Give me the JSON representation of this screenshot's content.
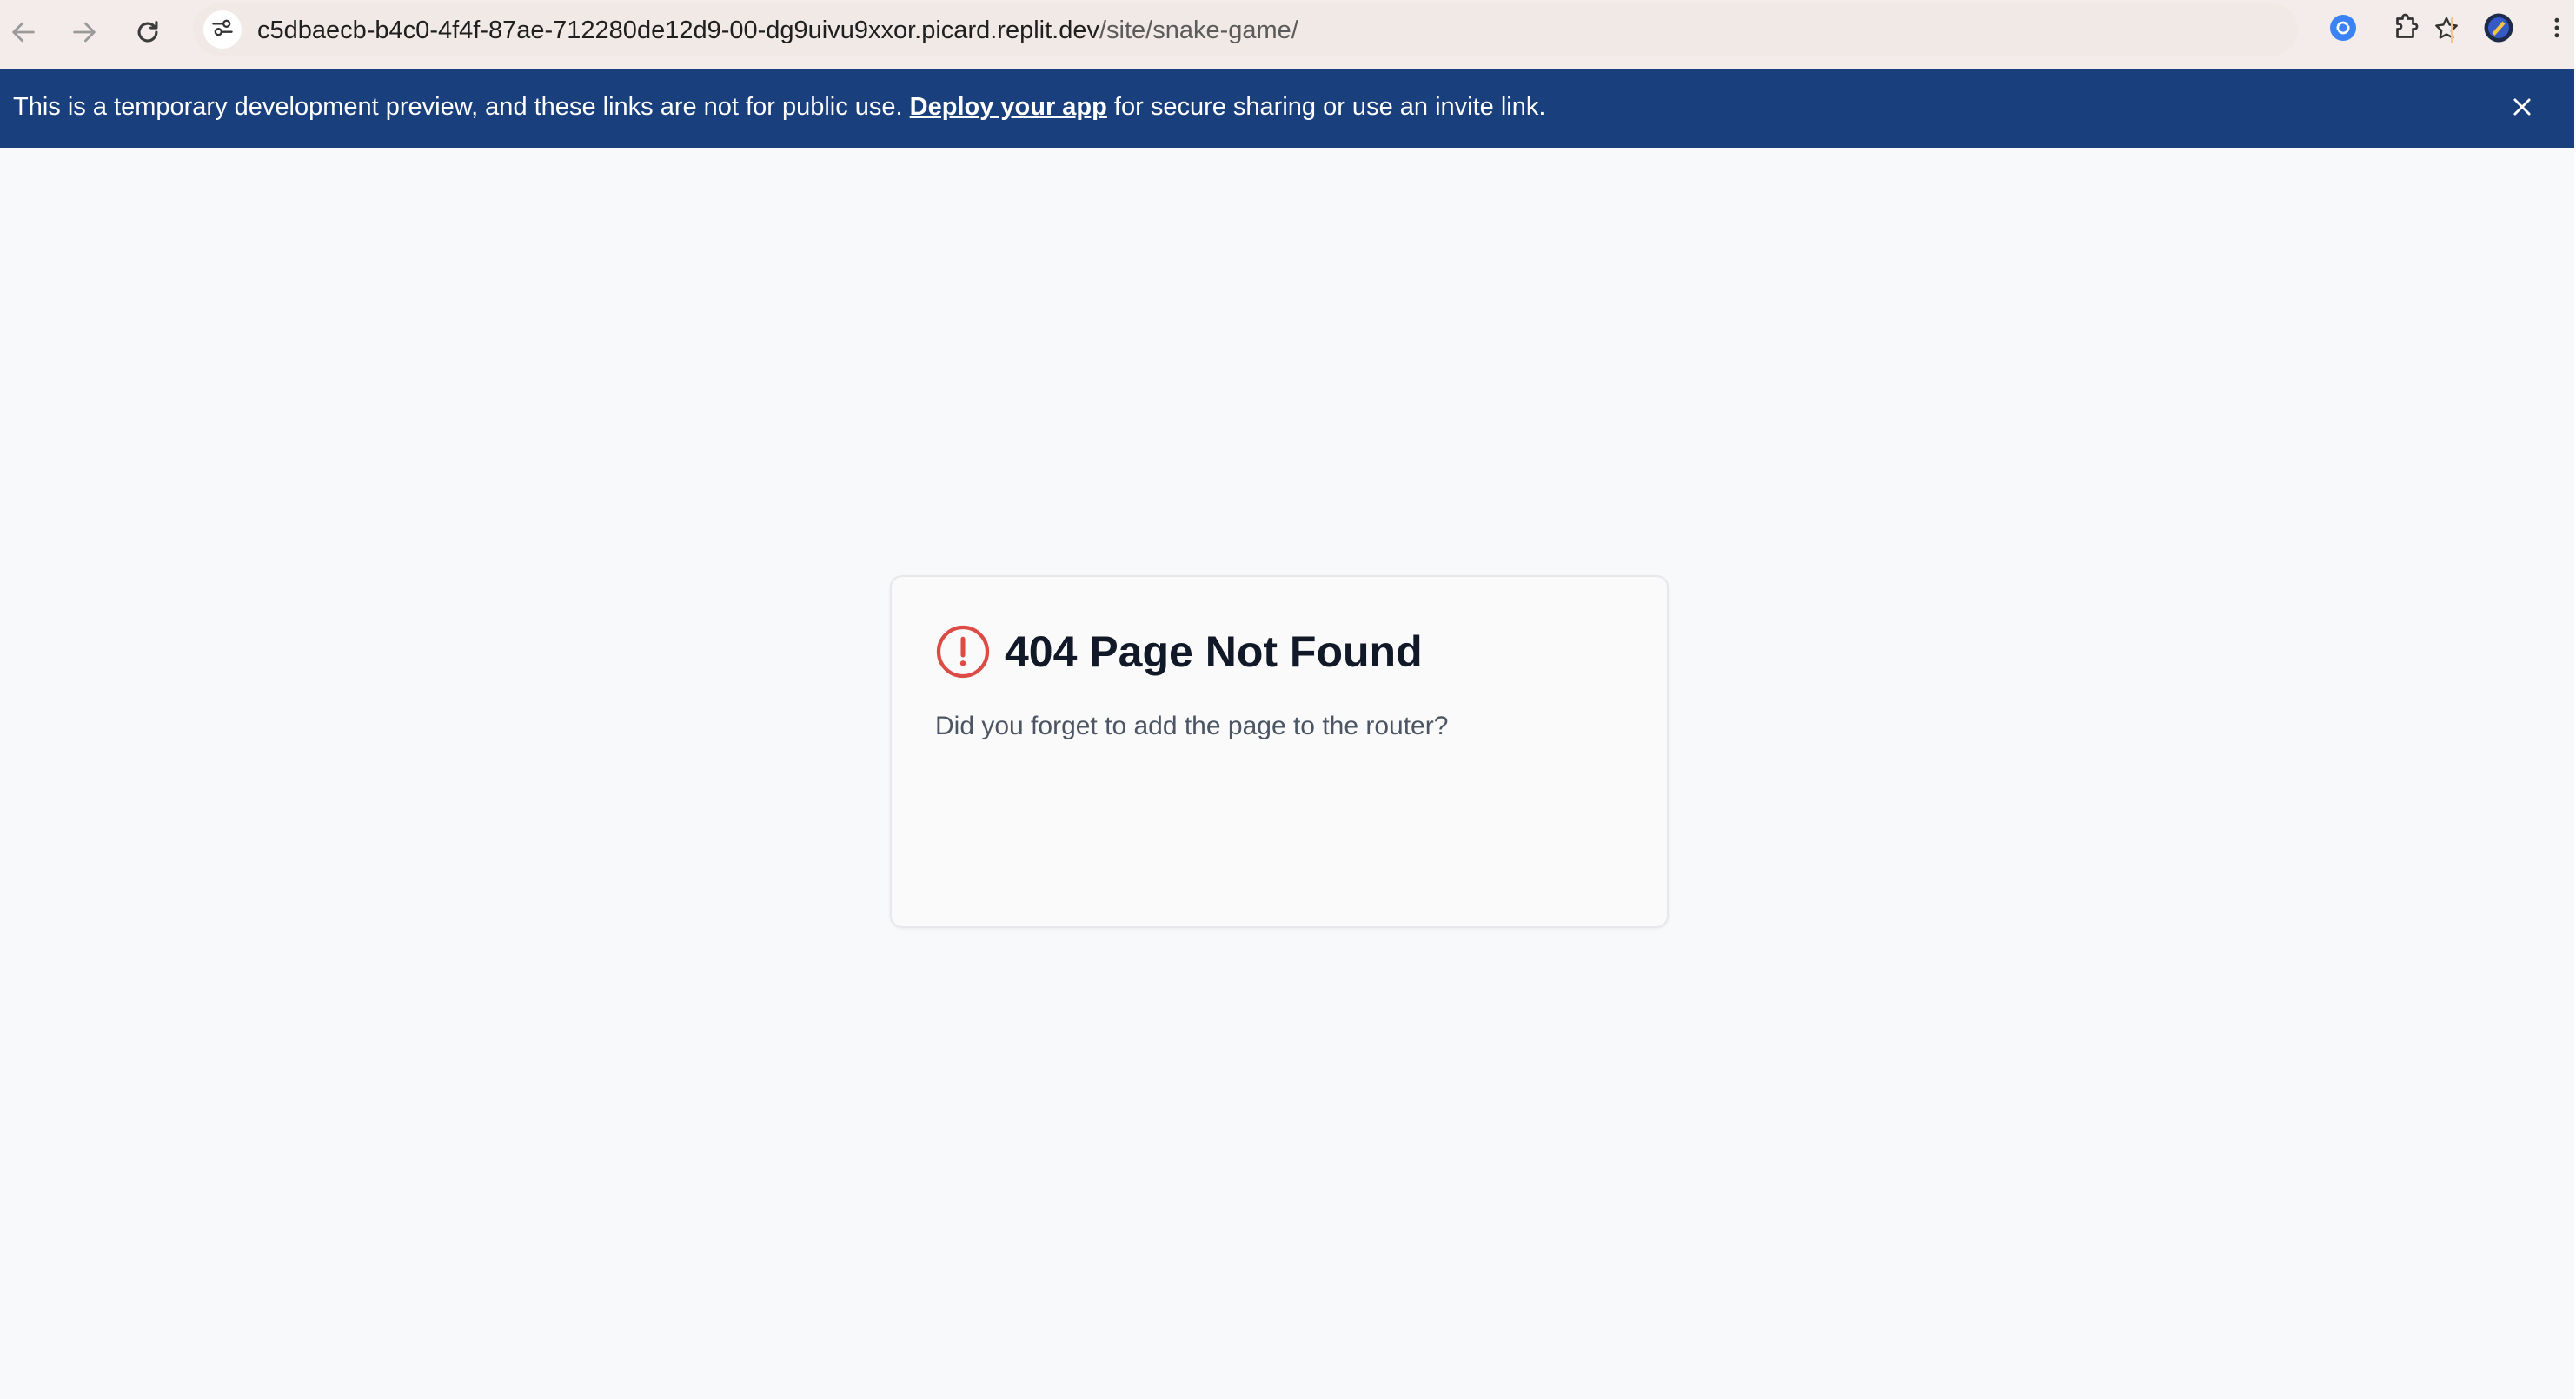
{
  "browser": {
    "url_host": "c5dbaecb-b4c0-4f4f-87ae-712280de12d9-00-dg9uivu9xxor.picard.replit.dev",
    "url_path": "/site/snake-game/",
    "icons": {
      "back": "arrow-left-icon",
      "forward": "arrow-right-icon",
      "reload": "reload-icon",
      "site_info": "tune-icon",
      "bookmark": "star-icon",
      "extension_1": "sync-icon",
      "extensions": "puzzle-icon",
      "profile": "avatar-icon",
      "menu": "more-vertical-icon"
    }
  },
  "banner": {
    "text_before": "This is a temporary development preview, and these links are not for public use.",
    "link_text": "Deploy your app",
    "text_after": "for secure sharing or use an invite link.",
    "close_icon": "close-icon"
  },
  "error_card": {
    "title": "404 Page Not Found",
    "message": "Did you forget to add the page to the router?",
    "icon": "alert-circle-icon"
  },
  "colors": {
    "banner_bg": "#193f7d",
    "page_bg": "#f8f9fb",
    "alert_red": "#dc4b45",
    "chrome_bg": "#f3ecea"
  }
}
